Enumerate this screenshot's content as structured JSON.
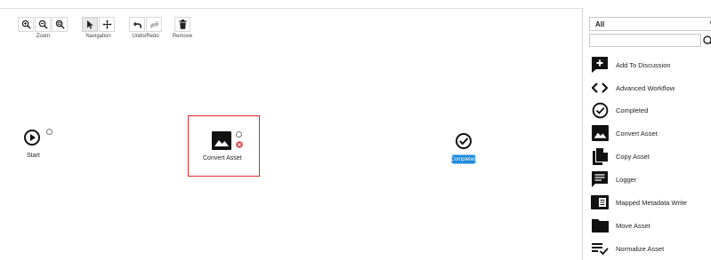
{
  "toolbar": {
    "zoom_label": "Zoom",
    "navigation_label": "Navigation",
    "undo_redo_label": "Undo/Redo",
    "remove_label": "Remove"
  },
  "canvas": {
    "start_label": "Start",
    "convert_asset_label": "Convert Asset",
    "completed_badge": "Completed"
  },
  "panel": {
    "filter_value": "All",
    "filter_chevron": "˅",
    "search_value": "",
    "items": [
      {
        "label": "Add To Discussion",
        "icon": "add-comment-icon"
      },
      {
        "label": "Advanced Workflow",
        "icon": "code-brackets-icon"
      },
      {
        "label": "Completed",
        "icon": "check-circle-icon"
      },
      {
        "label": "Convert Asset",
        "icon": "image-icon"
      },
      {
        "label": "Copy Asset",
        "icon": "copy-file-icon"
      },
      {
        "label": "Logger",
        "icon": "message-icon"
      },
      {
        "label": "Mapped Metadata Write",
        "icon": "metadata-icon"
      },
      {
        "label": "Move Asset",
        "icon": "folder-icon"
      },
      {
        "label": "Normalize Asset",
        "icon": "list-check-icon"
      }
    ]
  },
  "colors": {
    "selection_border": "#e0262a",
    "badge_blue": "#1f8ad9",
    "error_red": "#e34545"
  }
}
